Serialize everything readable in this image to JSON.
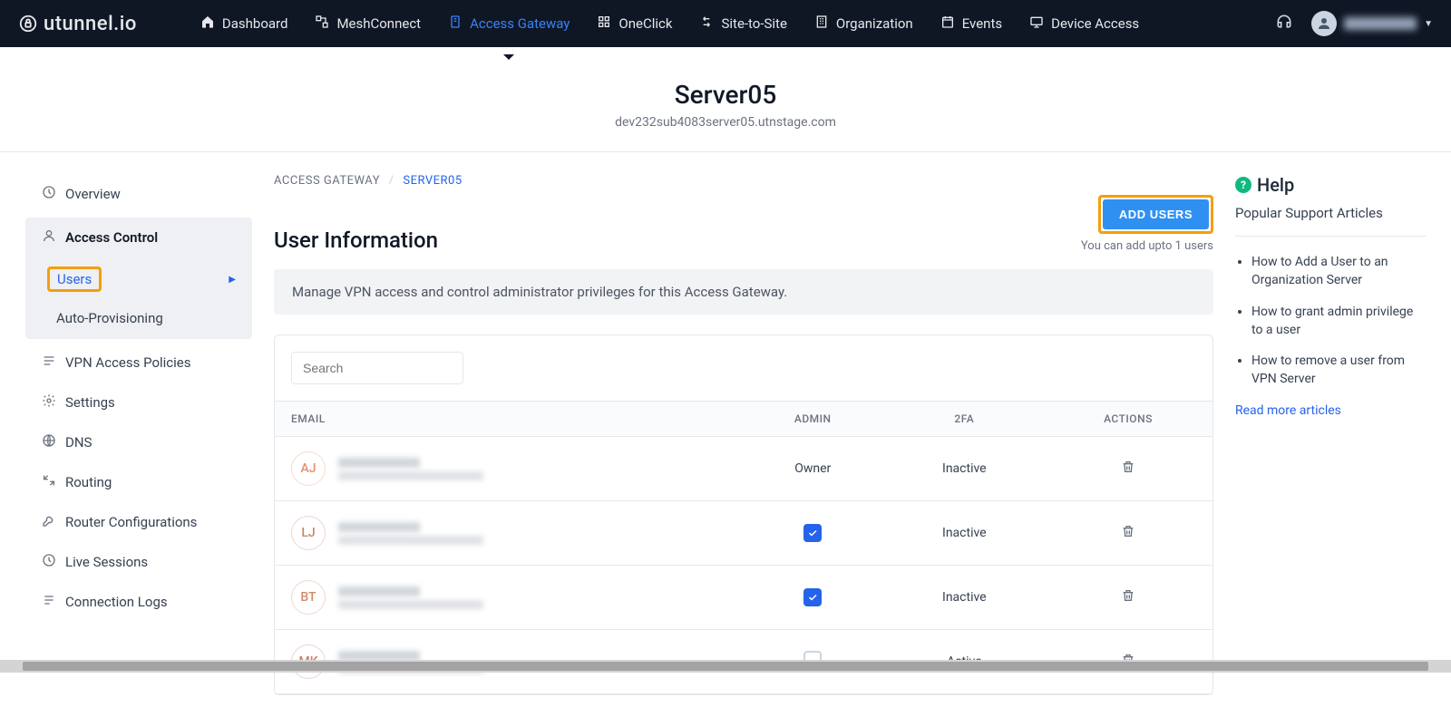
{
  "brand": "utunnel.io",
  "nav": {
    "items": [
      {
        "label": "Dashboard",
        "icon": "home"
      },
      {
        "label": "MeshConnect",
        "icon": "mesh"
      },
      {
        "label": "Access Gateway",
        "icon": "gateway",
        "active": true
      },
      {
        "label": "OneClick",
        "icon": "oneclick"
      },
      {
        "label": "Site-to-Site",
        "icon": "s2s"
      },
      {
        "label": "Organization",
        "icon": "org"
      },
      {
        "label": "Events",
        "icon": "events"
      },
      {
        "label": "Device Access",
        "icon": "device"
      }
    ]
  },
  "header": {
    "title": "Server05",
    "subdomain": "dev232sub4083server05.utnstage.com"
  },
  "sidebar": {
    "items": [
      {
        "label": "Overview",
        "icon": "clock"
      },
      {
        "label": "Access Control",
        "icon": "user",
        "group": true,
        "expanded": true,
        "children": [
          {
            "label": "Users",
            "active": true,
            "highlight": true
          },
          {
            "label": "Auto-Provisioning"
          }
        ]
      },
      {
        "label": "VPN Access Policies",
        "icon": "policies"
      },
      {
        "label": "Settings",
        "icon": "gear"
      },
      {
        "label": "DNS",
        "icon": "globe"
      },
      {
        "label": "Routing",
        "icon": "routing"
      },
      {
        "label": "Router Configurations",
        "icon": "wrench"
      },
      {
        "label": "Live Sessions",
        "icon": "clock"
      },
      {
        "label": "Connection Logs",
        "icon": "logs"
      }
    ]
  },
  "breadcrumb": {
    "root": "ACCESS GATEWAY",
    "current": "SERVER05"
  },
  "page": {
    "title": "User Information",
    "add_button": "ADD USERS",
    "quota": "You can add upto 1 users",
    "banner": "Manage VPN access and control administrator privileges for this Access Gateway.",
    "search_placeholder": "Search"
  },
  "table": {
    "columns": {
      "email": "EMAIL",
      "admin": "ADMIN",
      "tfa": "2FA",
      "actions": "ACTIONS"
    },
    "rows": [
      {
        "initials": "AJ",
        "color": "#e8906b",
        "admin": "owner",
        "owner_label": "Owner",
        "tfa": "Inactive"
      },
      {
        "initials": "LJ",
        "color": "#c7846b",
        "admin": "checked",
        "tfa": "Inactive"
      },
      {
        "initials": "BT",
        "color": "#d08b6a",
        "admin": "checked",
        "tfa": "Inactive"
      },
      {
        "initials": "MK",
        "color": "#c97f63",
        "admin": "unchecked",
        "tfa": "Active"
      }
    ]
  },
  "help": {
    "title": "Help",
    "subtitle": "Popular Support Articles",
    "articles": [
      "How to Add a User to an Organization Server",
      "How to grant admin privilege to a user",
      "How to remove a user from VPN Server"
    ],
    "more": "Read more articles"
  }
}
